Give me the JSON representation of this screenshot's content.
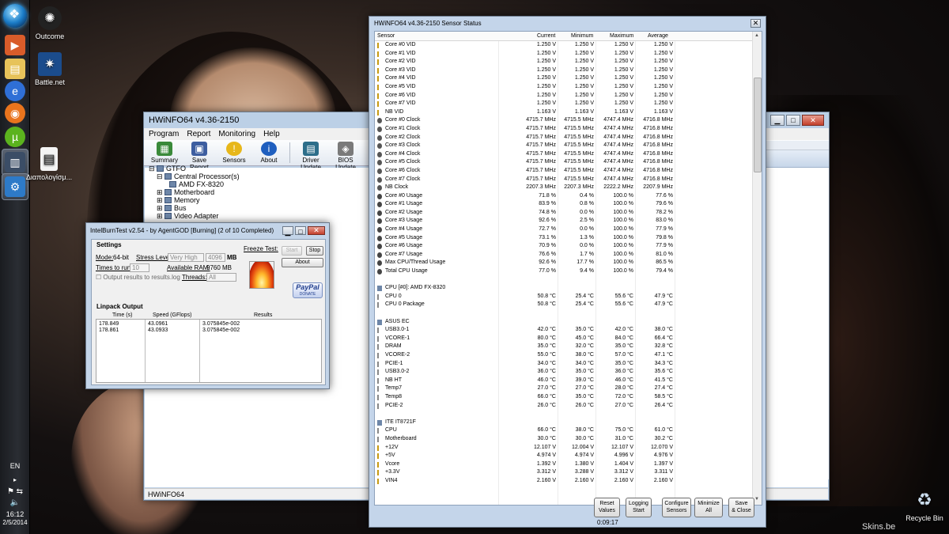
{
  "desktop": {
    "icons": [
      {
        "label": "Outcome",
        "icon": "outcome-app-icon"
      },
      {
        "label": "Battle.net",
        "icon": "battlenet-icon"
      },
      {
        "label": "Διαπολογίσμ...",
        "icon": "document-icon"
      },
      {
        "label": "Recycle Bin",
        "icon": "recycle-bin-icon"
      }
    ],
    "watermark": "Skins.be"
  },
  "taskbar": {
    "lang": "EN",
    "time": "16:12",
    "date": "2/5/2014"
  },
  "hwinfo_main": {
    "title": "HWiNFO64 v4.36-2150",
    "menu": [
      "Program",
      "Report",
      "Monitoring",
      "Help"
    ],
    "toolbar": [
      "Summary",
      "Save Report",
      "Sensors",
      "About",
      "Driver Update",
      "BIOS Update"
    ],
    "tree": [
      "GTFO",
      "Central Processor(s)",
      "AMD FX-8320",
      "Motherboard",
      "Memory",
      "Bus",
      "Video Adapter"
    ],
    "status": "HWiNFO64"
  },
  "ibt": {
    "title": "IntelBurnTest v2.54 - by AgentGOD [Burning] (2 of 10 Completed)",
    "settings_label": "Settings",
    "mode_label": "Mode:",
    "mode_value": "64-bit",
    "stress_label": "Stress Level:",
    "stress_value": "Very High",
    "mb_value": "4096",
    "mb_unit": "MB",
    "times_label": "Times to run:",
    "times_value": "10",
    "ram_label": "Available RAM:",
    "ram_value": "9760 MB",
    "output_label": "Output results to results.log",
    "threads_label": "Threads:",
    "threads_value": "All",
    "freeze_label": "Freeze Test:",
    "start": "Start",
    "stop": "Stop",
    "about": "About",
    "paypal": "PayPal",
    "donate": "DONATE",
    "linpack_label": "Linpack Output",
    "col_time": "Time (s)",
    "col_speed": "Speed (GFlops)",
    "col_results": "Results",
    "rows": [
      {
        "time": "178.849",
        "speed": "43.0961",
        "result": "3.075845e-002"
      },
      {
        "time": "178.861",
        "speed": "43.0933",
        "result": "3.075845e-002"
      }
    ]
  },
  "sensor": {
    "title": "HWiNFO64 v4.36-2150 Sensor Status",
    "headers": [
      "Sensor",
      "Current",
      "Minimum",
      "Maximum",
      "Average"
    ],
    "rows": [
      {
        "n": "Core #0 VID",
        "i": "volt",
        "c": "1.250 V",
        "mn": "1.250 V",
        "mx": "1.250 V",
        "a": "1.250 V"
      },
      {
        "n": "Core #1 VID",
        "i": "volt",
        "c": "1.250 V",
        "mn": "1.250 V",
        "mx": "1.250 V",
        "a": "1.250 V"
      },
      {
        "n": "Core #2 VID",
        "i": "volt",
        "c": "1.250 V",
        "mn": "1.250 V",
        "mx": "1.250 V",
        "a": "1.250 V"
      },
      {
        "n": "Core #3 VID",
        "i": "volt",
        "c": "1.250 V",
        "mn": "1.250 V",
        "mx": "1.250 V",
        "a": "1.250 V"
      },
      {
        "n": "Core #4 VID",
        "i": "volt",
        "c": "1.250 V",
        "mn": "1.250 V",
        "mx": "1.250 V",
        "a": "1.250 V"
      },
      {
        "n": "Core #5 VID",
        "i": "volt",
        "c": "1.250 V",
        "mn": "1.250 V",
        "mx": "1.250 V",
        "a": "1.250 V"
      },
      {
        "n": "Core #6 VID",
        "i": "volt",
        "c": "1.250 V",
        "mn": "1.250 V",
        "mx": "1.250 V",
        "a": "1.250 V"
      },
      {
        "n": "Core #7 VID",
        "i": "volt",
        "c": "1.250 V",
        "mn": "1.250 V",
        "mx": "1.250 V",
        "a": "1.250 V"
      },
      {
        "n": "NB VID",
        "i": "volt",
        "c": "1.163 V",
        "mn": "1.163 V",
        "mx": "1.163 V",
        "a": "1.163 V"
      },
      {
        "n": "Core #0 Clock",
        "i": "clock",
        "c": "4715.7 MHz",
        "mn": "4715.5 MHz",
        "mx": "4747.4 MHz",
        "a": "4716.8 MHz"
      },
      {
        "n": "Core #1 Clock",
        "i": "clock",
        "c": "4715.7 MHz",
        "mn": "4715.5 MHz",
        "mx": "4747.4 MHz",
        "a": "4716.8 MHz"
      },
      {
        "n": "Core #2 Clock",
        "i": "clock",
        "c": "4715.7 MHz",
        "mn": "4715.5 MHz",
        "mx": "4747.4 MHz",
        "a": "4716.8 MHz"
      },
      {
        "n": "Core #3 Clock",
        "i": "clock",
        "c": "4715.7 MHz",
        "mn": "4715.5 MHz",
        "mx": "4747.4 MHz",
        "a": "4716.8 MHz"
      },
      {
        "n": "Core #4 Clock",
        "i": "clock",
        "c": "4715.7 MHz",
        "mn": "4715.5 MHz",
        "mx": "4747.4 MHz",
        "a": "4716.8 MHz"
      },
      {
        "n": "Core #5 Clock",
        "i": "clock",
        "c": "4715.7 MHz",
        "mn": "4715.5 MHz",
        "mx": "4747.4 MHz",
        "a": "4716.8 MHz"
      },
      {
        "n": "Core #6 Clock",
        "i": "clock",
        "c": "4715.7 MHz",
        "mn": "4715.5 MHz",
        "mx": "4747.4 MHz",
        "a": "4716.8 MHz"
      },
      {
        "n": "Core #7 Clock",
        "i": "clock",
        "c": "4715.7 MHz",
        "mn": "4715.5 MHz",
        "mx": "4747.4 MHz",
        "a": "4716.8 MHz"
      },
      {
        "n": "NB Clock",
        "i": "clock",
        "c": "2207.3 MHz",
        "mn": "2207.3 MHz",
        "mx": "2222.2 MHz",
        "a": "2207.9 MHz"
      },
      {
        "n": "Core #0 Usage",
        "i": "usage",
        "c": "71.8 %",
        "mn": "0.4 %",
        "mx": "100.0 %",
        "a": "77.6 %"
      },
      {
        "n": "Core #1 Usage",
        "i": "usage",
        "c": "83.9 %",
        "mn": "0.8 %",
        "mx": "100.0 %",
        "a": "79.6 %"
      },
      {
        "n": "Core #2 Usage",
        "i": "usage",
        "c": "74.8 %",
        "mn": "0.0 %",
        "mx": "100.0 %",
        "a": "78.2 %"
      },
      {
        "n": "Core #3 Usage",
        "i": "usage",
        "c": "92.6 %",
        "mn": "2.5 %",
        "mx": "100.0 %",
        "a": "83.0 %"
      },
      {
        "n": "Core #4 Usage",
        "i": "usage",
        "c": "72.7 %",
        "mn": "0.0 %",
        "mx": "100.0 %",
        "a": "77.9 %"
      },
      {
        "n": "Core #5 Usage",
        "i": "usage",
        "c": "73.1 %",
        "mn": "1.3 %",
        "mx": "100.0 %",
        "a": "79.8 %"
      },
      {
        "n": "Core #6 Usage",
        "i": "usage",
        "c": "70.9 %",
        "mn": "0.0 %",
        "mx": "100.0 %",
        "a": "77.9 %"
      },
      {
        "n": "Core #7 Usage",
        "i": "usage",
        "c": "76.6 %",
        "mn": "1.7 %",
        "mx": "100.0 %",
        "a": "81.0 %"
      },
      {
        "n": "Max CPU/Thread Usage",
        "i": "usage",
        "c": "92.6 %",
        "mn": "17.7 %",
        "mx": "100.0 %",
        "a": "86.5 %"
      },
      {
        "n": "Total CPU Usage",
        "i": "usage",
        "c": "77.0 %",
        "mn": "9.4 %",
        "mx": "100.0 %",
        "a": "79.4 %"
      },
      {
        "n": "",
        "i": "",
        "c": "",
        "mn": "",
        "mx": "",
        "a": ""
      },
      {
        "n": "CPU [#0]: AMD FX-8320",
        "i": "chip",
        "c": "",
        "mn": "",
        "mx": "",
        "a": ""
      },
      {
        "n": "CPU 0",
        "i": "temp",
        "c": "50.8 °C",
        "mn": "25.4 °C",
        "mx": "55.6 °C",
        "a": "47.9 °C"
      },
      {
        "n": "CPU 0 Package",
        "i": "temp",
        "c": "50.8 °C",
        "mn": "25.4 °C",
        "mx": "55.6 °C",
        "a": "47.9 °C"
      },
      {
        "n": "",
        "i": "",
        "c": "",
        "mn": "",
        "mx": "",
        "a": ""
      },
      {
        "n": "ASUS EC",
        "i": "chip",
        "c": "",
        "mn": "",
        "mx": "",
        "a": ""
      },
      {
        "n": "USB3.0-1",
        "i": "temp",
        "c": "42.0 °C",
        "mn": "35.0 °C",
        "mx": "42.0 °C",
        "a": "38.0 °C"
      },
      {
        "n": "VCORE-1",
        "i": "temp",
        "c": "80.0 °C",
        "mn": "45.0 °C",
        "mx": "84.0 °C",
        "a": "66.4 °C"
      },
      {
        "n": "DRAM",
        "i": "temp",
        "c": "35.0 °C",
        "mn": "32.0 °C",
        "mx": "35.0 °C",
        "a": "32.8 °C"
      },
      {
        "n": "VCORE-2",
        "i": "temp",
        "c": "55.0 °C",
        "mn": "38.0 °C",
        "mx": "57.0 °C",
        "a": "47.1 °C"
      },
      {
        "n": "PCIE-1",
        "i": "temp",
        "c": "34.0 °C",
        "mn": "34.0 °C",
        "mx": "35.0 °C",
        "a": "34.3 °C"
      },
      {
        "n": "USB3.0-2",
        "i": "temp",
        "c": "36.0 °C",
        "mn": "35.0 °C",
        "mx": "36.0 °C",
        "a": "35.6 °C"
      },
      {
        "n": "NB HT",
        "i": "temp",
        "c": "46.0 °C",
        "mn": "39.0 °C",
        "mx": "46.0 °C",
        "a": "41.5 °C"
      },
      {
        "n": "Temp7",
        "i": "temp",
        "c": "27.0 °C",
        "mn": "27.0 °C",
        "mx": "28.0 °C",
        "a": "27.4 °C"
      },
      {
        "n": "Temp8",
        "i": "temp",
        "c": "66.0 °C",
        "mn": "35.0 °C",
        "mx": "72.0 °C",
        "a": "58.5 °C"
      },
      {
        "n": "PCIE-2",
        "i": "temp",
        "c": "26.0 °C",
        "mn": "26.0 °C",
        "mx": "27.0 °C",
        "a": "26.4 °C"
      },
      {
        "n": "",
        "i": "",
        "c": "",
        "mn": "",
        "mx": "",
        "a": ""
      },
      {
        "n": "ITE IT8721F",
        "i": "chip",
        "c": "",
        "mn": "",
        "mx": "",
        "a": ""
      },
      {
        "n": "CPU",
        "i": "temp",
        "c": "66.0 °C",
        "mn": "38.0 °C",
        "mx": "75.0 °C",
        "a": "61.0 °C"
      },
      {
        "n": "Motherboard",
        "i": "temp",
        "c": "30.0 °C",
        "mn": "30.0 °C",
        "mx": "31.0 °C",
        "a": "30.2 °C"
      },
      {
        "n": "+12V",
        "i": "volt",
        "c": "12.107 V",
        "mn": "12.004 V",
        "mx": "12.107 V",
        "a": "12.070 V"
      },
      {
        "n": "+5V",
        "i": "volt",
        "c": "4.974 V",
        "mn": "4.974 V",
        "mx": "4.996 V",
        "a": "4.976 V"
      },
      {
        "n": "Vcore",
        "i": "volt",
        "c": "1.392 V",
        "mn": "1.380 V",
        "mx": "1.404 V",
        "a": "1.397 V"
      },
      {
        "n": "+3.3V",
        "i": "volt",
        "c": "3.312 V",
        "mn": "3.288 V",
        "mx": "3.312 V",
        "a": "3.311 V"
      },
      {
        "n": "VIN4",
        "i": "volt",
        "c": "2.160 V",
        "mn": "2.160 V",
        "mx": "2.160 V",
        "a": "2.160 V"
      }
    ],
    "buttons": [
      {
        "l1": "Reset",
        "l2": "Values"
      },
      {
        "l1": "Logging",
        "l2": "Start"
      },
      {
        "l1": "Configure",
        "l2": "Sensors"
      },
      {
        "l1": "Minimize",
        "l2": "All"
      },
      {
        "l1": "Save",
        "l2": "& Close"
      }
    ],
    "timer": "0:09:17"
  }
}
